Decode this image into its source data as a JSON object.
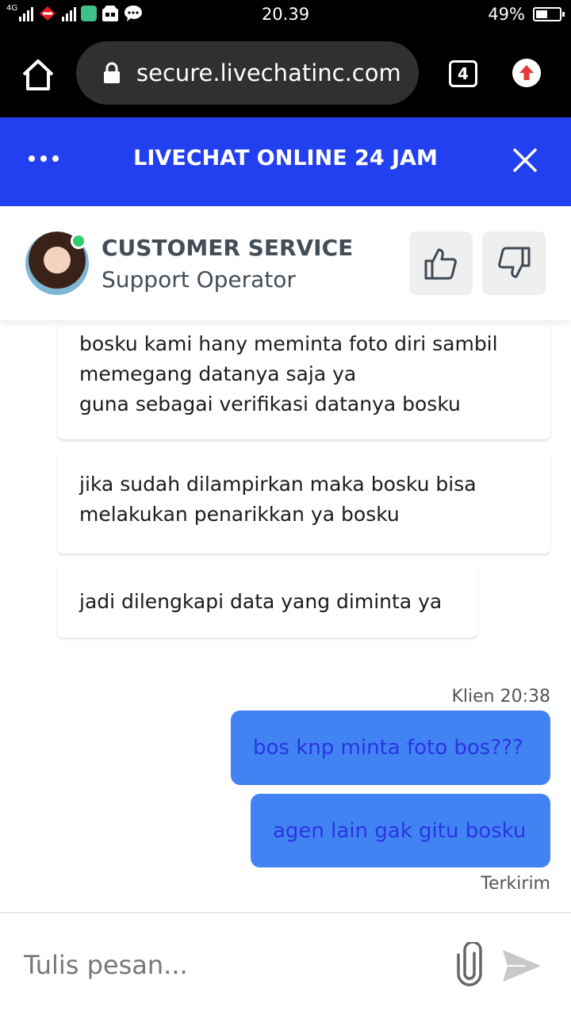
{
  "status_bar": {
    "network_label": "4G",
    "time": "20.39",
    "battery_percent": "49%",
    "battery_level": 0.49
  },
  "browser": {
    "url": "secure.livechatinc.com",
    "tab_count": "4",
    "home_icon": "home-icon",
    "lock_icon": "lock-icon",
    "update_icon": "upload-arrow-icon"
  },
  "header": {
    "title": "LIVECHAT ONLINE 24 JAM",
    "menu_icon": "more-dots-icon",
    "close_icon": "close-icon",
    "color": "#2340f0"
  },
  "agent": {
    "name": "CUSTOMER SERVICE",
    "role": "Support Operator",
    "status": "online",
    "status_color": "#2ecc71"
  },
  "messages_in": [
    {
      "lines": [
        "bosku kami hany meminta foto diri sambil",
        "memegang datanya saja ya",
        "guna sebagai verifikasi datanya bosku"
      ]
    },
    {
      "lines": [
        "jika sudah dilampirkan maka bosku bisa",
        "melakukan penarikkan ya bosku"
      ]
    },
    {
      "lines": [
        "jadi dilengkapi data yang diminta ya"
      ]
    }
  ],
  "client_meta": "Klien 20:38",
  "messages_out": [
    {
      "text": "bos knp minta foto bos???"
    },
    {
      "text": "agen lain gak gitu bosku"
    }
  ],
  "delivery_status": "Terkirim",
  "composer": {
    "placeholder": "Tulis pesan...",
    "attach_icon": "paperclip-icon",
    "send_icon": "send-icon"
  },
  "colors": {
    "accent": "#2340f0",
    "outgoing_bubble": "#4283f4",
    "outgoing_text": "#2a35e0"
  }
}
